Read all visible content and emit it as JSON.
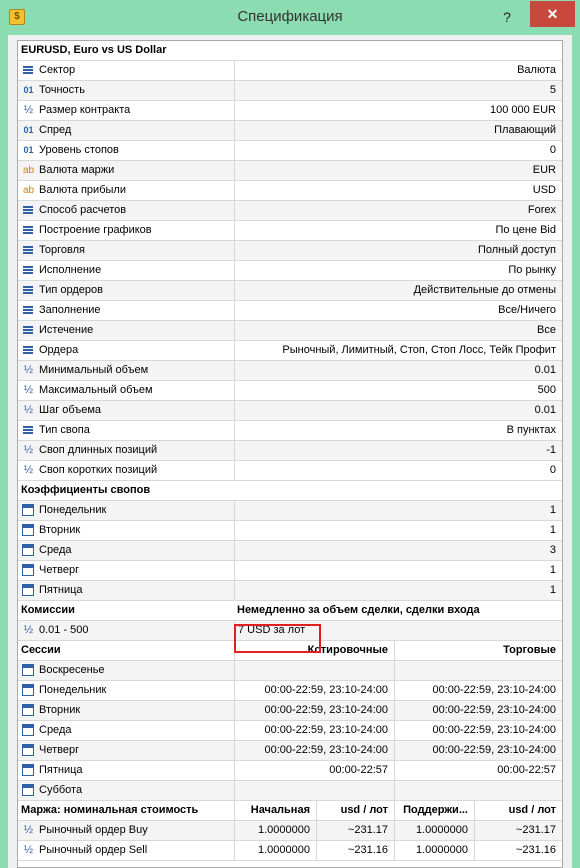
{
  "window": {
    "title": "Спецификация",
    "help": "?",
    "close": "✕"
  },
  "symbol_header": "EURUSD, Euro vs US Dollar",
  "properties": [
    {
      "icon": "list-icon",
      "label": "Сектор",
      "value": "Валюта"
    },
    {
      "icon": "digits-icon",
      "label": "Точность",
      "value": "5"
    },
    {
      "icon": "fraction-icon",
      "label": "Размер контракта",
      "value": "100 000 EUR"
    },
    {
      "icon": "digits-icon",
      "label": "Спред",
      "value": "Плавающий"
    },
    {
      "icon": "digits-icon",
      "label": "Уровень стопов",
      "value": "0"
    },
    {
      "icon": "text-icon",
      "label": "Валюта маржи",
      "value": "EUR"
    },
    {
      "icon": "text-icon",
      "label": "Валюта прибыли",
      "value": "USD"
    },
    {
      "icon": "list-icon",
      "label": "Способ расчетов",
      "value": "Forex"
    },
    {
      "icon": "list-icon",
      "label": "Построение графиков",
      "value": "По цене Bid"
    },
    {
      "icon": "list-icon",
      "label": "Торговля",
      "value": "Полный доступ"
    },
    {
      "icon": "list-icon",
      "label": "Исполнение",
      "value": "По рынку"
    },
    {
      "icon": "list-icon",
      "label": "Тип ордеров",
      "value": "Действительные до отмены"
    },
    {
      "icon": "list-icon",
      "label": "Заполнение",
      "value": "Все/Ничего"
    },
    {
      "icon": "list-icon",
      "label": "Истечение",
      "value": "Все"
    },
    {
      "icon": "list-icon",
      "label": "Ордера",
      "value": "Рыночный, Лимитный, Стоп, Стоп Лосс, Тейк Профит"
    },
    {
      "icon": "fraction-icon",
      "label": "Минимальный объем",
      "value": "0.01"
    },
    {
      "icon": "fraction-icon",
      "label": "Максимальный объем",
      "value": "500"
    },
    {
      "icon": "fraction-icon",
      "label": "Шаг объема",
      "value": "0.01"
    },
    {
      "icon": "list-icon",
      "label": "Тип свопа",
      "value": "В пунктах"
    },
    {
      "icon": "fraction-icon",
      "label": "Своп длинных позиций",
      "value": "-1"
    },
    {
      "icon": "fraction-icon",
      "label": "Своп коротких позиций",
      "value": "0"
    }
  ],
  "swap_coefficients": {
    "header": "Коэффициенты свопов",
    "days": [
      {
        "label": "Понедельник",
        "value": "1"
      },
      {
        "label": "Вторник",
        "value": "1"
      },
      {
        "label": "Среда",
        "value": "3"
      },
      {
        "label": "Четверг",
        "value": "1"
      },
      {
        "label": "Пятница",
        "value": "1"
      }
    ]
  },
  "commissions": {
    "header": "Комиссии",
    "header_value": "Немедленно за объем сделки, сделки входа",
    "range": "0.01 - 500",
    "value": "7 USD за лот"
  },
  "sessions": {
    "header": "Сессии",
    "col_quotes": "Котировочные",
    "col_trade": "Торговые",
    "days": [
      {
        "label": "Воскресенье",
        "quotes": "",
        "trade": ""
      },
      {
        "label": "Понедельник",
        "quotes": "00:00-22:59, 23:10-24:00",
        "trade": "00:00-22:59, 23:10-24:00"
      },
      {
        "label": "Вторник",
        "quotes": "00:00-22:59, 23:10-24:00",
        "trade": "00:00-22:59, 23:10-24:00"
      },
      {
        "label": "Среда",
        "quotes": "00:00-22:59, 23:10-24:00",
        "trade": "00:00-22:59, 23:10-24:00"
      },
      {
        "label": "Четверг",
        "quotes": "00:00-22:59, 23:10-24:00",
        "trade": "00:00-22:59, 23:10-24:00"
      },
      {
        "label": "Пятница",
        "quotes": "00:00-22:57",
        "trade": "00:00-22:57"
      },
      {
        "label": "Суббота",
        "quotes": "",
        "trade": ""
      }
    ]
  },
  "margin": {
    "header": "Маржа: номинальная стоимость",
    "col1": "Начальная",
    "col2": "usd / лот",
    "col3": "Поддержи...",
    "col4": "usd / лот",
    "rows": [
      {
        "label": "Рыночный ордер Buy",
        "c1": "1.0000000",
        "c2": "~231.17",
        "c3": "1.0000000",
        "c4": "~231.17"
      },
      {
        "label": "Рыночный ордер Sell",
        "c1": "1.0000000",
        "c2": "~231.16",
        "c3": "1.0000000",
        "c4": "~231.16"
      }
    ]
  },
  "colors": {
    "titlebar": "#8bdcb0",
    "close": "#c7483c",
    "highlight": "#e01f1f",
    "icon": "#2e5fa8"
  }
}
